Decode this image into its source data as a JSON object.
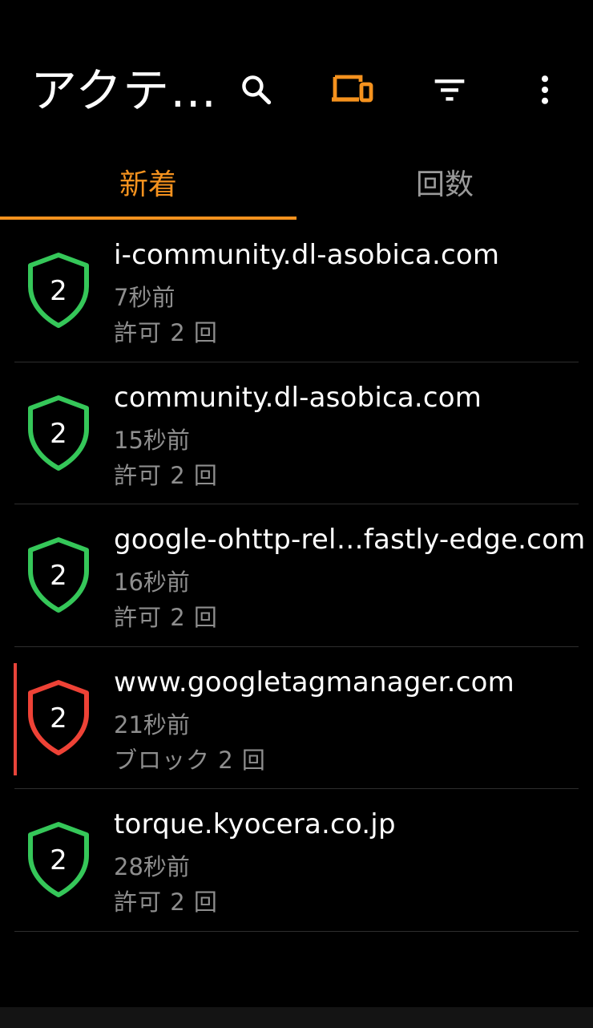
{
  "header": {
    "title": "アクテ…",
    "icons": [
      "search-icon",
      "devices-icon",
      "filter-icon",
      "more-vert-icon"
    ],
    "accent_color": "#f5921e"
  },
  "tabs": [
    {
      "label": "新着",
      "selected": true
    },
    {
      "label": "回数",
      "selected": false
    }
  ],
  "entries": [
    {
      "count": "2",
      "domain": "i-community.dl-asobica.com",
      "time": "7秒前",
      "status": "許可 2 回",
      "state": "allowed"
    },
    {
      "count": "2",
      "domain": "community.dl-asobica.com",
      "time": "15秒前",
      "status": "許可 2 回",
      "state": "allowed"
    },
    {
      "count": "2",
      "domain": "google-ohttp-rel…fastly-edge.com",
      "time": "16秒前",
      "status": "許可 2 回",
      "state": "allowed"
    },
    {
      "count": "2",
      "domain": "www.googletagmanager.com",
      "time": "21秒前",
      "status": "ブロック 2 回",
      "state": "blocked"
    },
    {
      "count": "2",
      "domain": "torque.kyocera.co.jp",
      "time": "28秒前",
      "status": "許可 2 回",
      "state": "allowed"
    }
  ],
  "colors": {
    "allowed": "#35c759",
    "blocked": "#ee4236"
  }
}
